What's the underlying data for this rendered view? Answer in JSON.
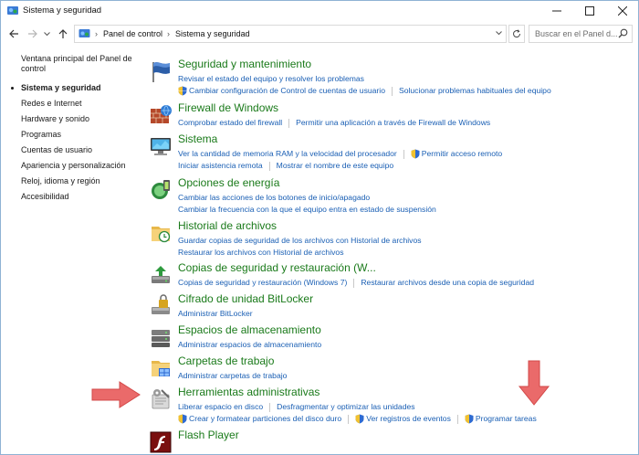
{
  "window": {
    "title": "Sistema y seguridad"
  },
  "address": {
    "crumbs": [
      "Panel de control",
      "Sistema y seguridad"
    ],
    "search_placeholder": "Buscar en el Panel d..."
  },
  "sidebar": {
    "home": "Ventana principal del Panel de control",
    "items": [
      {
        "label": "Sistema y seguridad",
        "active": true
      },
      {
        "label": "Redes e Internet"
      },
      {
        "label": "Hardware y sonido"
      },
      {
        "label": "Programas"
      },
      {
        "label": "Cuentas de usuario"
      },
      {
        "label": "Apariencia y personalización"
      },
      {
        "label": "Reloj, idioma y región"
      },
      {
        "label": "Accesibilidad"
      }
    ]
  },
  "categories": [
    {
      "heading": "Seguridad y mantenimiento",
      "rows": [
        [
          "Revisar el estado del equipo y resolver los problemas"
        ],
        [
          "Cambiar configuración de Control de cuentas de usuario",
          "Solucionar problemas habituales del equipo"
        ]
      ]
    },
    {
      "heading": "Firewall de Windows",
      "rows": [
        [
          "Comprobar estado del firewall",
          "Permitir una aplicación a través de Firewall de Windows"
        ]
      ]
    },
    {
      "heading": "Sistema",
      "rows": [
        [
          "Ver la cantidad de memoria RAM y la velocidad del procesador",
          "Permitir acceso remoto"
        ],
        [
          "Iniciar asistencia remota",
          "Mostrar el nombre de este equipo"
        ]
      ]
    },
    {
      "heading": "Opciones de energía",
      "rows": [
        [
          "Cambiar las acciones de los botones de inicio/apagado"
        ],
        [
          "Cambiar la frecuencia con la que el equipo entra en estado de suspensión"
        ]
      ]
    },
    {
      "heading": "Historial de archivos",
      "rows": [
        [
          "Guardar copias de seguridad de los archivos con Historial de archivos"
        ],
        [
          "Restaurar los archivos con Historial de archivos"
        ]
      ]
    },
    {
      "heading": "Copias de seguridad y restauración (W...",
      "rows": [
        [
          "Copias de seguridad y restauración (Windows 7)",
          "Restaurar archivos desde una copia de seguridad"
        ]
      ]
    },
    {
      "heading": "Cifrado de unidad BitLocker",
      "rows": [
        [
          "Administrar BitLocker"
        ]
      ]
    },
    {
      "heading": "Espacios de almacenamiento",
      "rows": [
        [
          "Administrar espacios de almacenamiento"
        ]
      ]
    },
    {
      "heading": "Carpetas de trabajo",
      "rows": [
        [
          "Administrar carpetas de trabajo"
        ]
      ]
    },
    {
      "heading": "Herramientas administrativas",
      "rows": [
        [
          "Liberar espacio en disco",
          "Desfragmentar y optimizar las unidades"
        ],
        [
          "Crear y formatear particiones del disco duro",
          "Ver registros de eventos",
          "Programar tareas"
        ]
      ]
    },
    {
      "heading": "Flash Player",
      "rows": []
    }
  ]
}
